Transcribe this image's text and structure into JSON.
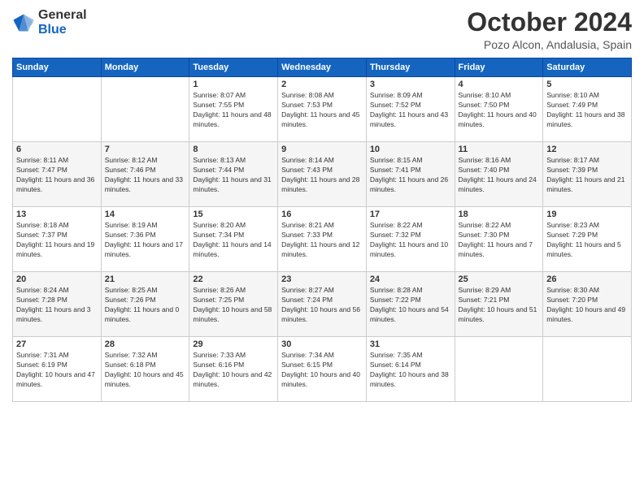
{
  "logo": {
    "general": "General",
    "blue": "Blue"
  },
  "header": {
    "month": "October 2024",
    "location": "Pozo Alcon, Andalusia, Spain"
  },
  "days_of_week": [
    "Sunday",
    "Monday",
    "Tuesday",
    "Wednesday",
    "Thursday",
    "Friday",
    "Saturday"
  ],
  "weeks": [
    [
      {
        "day": "",
        "info": ""
      },
      {
        "day": "",
        "info": ""
      },
      {
        "day": "1",
        "info": "Sunrise: 8:07 AM\nSunset: 7:55 PM\nDaylight: 11 hours and 48 minutes."
      },
      {
        "day": "2",
        "info": "Sunrise: 8:08 AM\nSunset: 7:53 PM\nDaylight: 11 hours and 45 minutes."
      },
      {
        "day": "3",
        "info": "Sunrise: 8:09 AM\nSunset: 7:52 PM\nDaylight: 11 hours and 43 minutes."
      },
      {
        "day": "4",
        "info": "Sunrise: 8:10 AM\nSunset: 7:50 PM\nDaylight: 11 hours and 40 minutes."
      },
      {
        "day": "5",
        "info": "Sunrise: 8:10 AM\nSunset: 7:49 PM\nDaylight: 11 hours and 38 minutes."
      }
    ],
    [
      {
        "day": "6",
        "info": "Sunrise: 8:11 AM\nSunset: 7:47 PM\nDaylight: 11 hours and 36 minutes."
      },
      {
        "day": "7",
        "info": "Sunrise: 8:12 AM\nSunset: 7:46 PM\nDaylight: 11 hours and 33 minutes."
      },
      {
        "day": "8",
        "info": "Sunrise: 8:13 AM\nSunset: 7:44 PM\nDaylight: 11 hours and 31 minutes."
      },
      {
        "day": "9",
        "info": "Sunrise: 8:14 AM\nSunset: 7:43 PM\nDaylight: 11 hours and 28 minutes."
      },
      {
        "day": "10",
        "info": "Sunrise: 8:15 AM\nSunset: 7:41 PM\nDaylight: 11 hours and 26 minutes."
      },
      {
        "day": "11",
        "info": "Sunrise: 8:16 AM\nSunset: 7:40 PM\nDaylight: 11 hours and 24 minutes."
      },
      {
        "day": "12",
        "info": "Sunrise: 8:17 AM\nSunset: 7:39 PM\nDaylight: 11 hours and 21 minutes."
      }
    ],
    [
      {
        "day": "13",
        "info": "Sunrise: 8:18 AM\nSunset: 7:37 PM\nDaylight: 11 hours and 19 minutes."
      },
      {
        "day": "14",
        "info": "Sunrise: 8:19 AM\nSunset: 7:36 PM\nDaylight: 11 hours and 17 minutes."
      },
      {
        "day": "15",
        "info": "Sunrise: 8:20 AM\nSunset: 7:34 PM\nDaylight: 11 hours and 14 minutes."
      },
      {
        "day": "16",
        "info": "Sunrise: 8:21 AM\nSunset: 7:33 PM\nDaylight: 11 hours and 12 minutes."
      },
      {
        "day": "17",
        "info": "Sunrise: 8:22 AM\nSunset: 7:32 PM\nDaylight: 11 hours and 10 minutes."
      },
      {
        "day": "18",
        "info": "Sunrise: 8:22 AM\nSunset: 7:30 PM\nDaylight: 11 hours and 7 minutes."
      },
      {
        "day": "19",
        "info": "Sunrise: 8:23 AM\nSunset: 7:29 PM\nDaylight: 11 hours and 5 minutes."
      }
    ],
    [
      {
        "day": "20",
        "info": "Sunrise: 8:24 AM\nSunset: 7:28 PM\nDaylight: 11 hours and 3 minutes."
      },
      {
        "day": "21",
        "info": "Sunrise: 8:25 AM\nSunset: 7:26 PM\nDaylight: 11 hours and 0 minutes."
      },
      {
        "day": "22",
        "info": "Sunrise: 8:26 AM\nSunset: 7:25 PM\nDaylight: 10 hours and 58 minutes."
      },
      {
        "day": "23",
        "info": "Sunrise: 8:27 AM\nSunset: 7:24 PM\nDaylight: 10 hours and 56 minutes."
      },
      {
        "day": "24",
        "info": "Sunrise: 8:28 AM\nSunset: 7:22 PM\nDaylight: 10 hours and 54 minutes."
      },
      {
        "day": "25",
        "info": "Sunrise: 8:29 AM\nSunset: 7:21 PM\nDaylight: 10 hours and 51 minutes."
      },
      {
        "day": "26",
        "info": "Sunrise: 8:30 AM\nSunset: 7:20 PM\nDaylight: 10 hours and 49 minutes."
      }
    ],
    [
      {
        "day": "27",
        "info": "Sunrise: 7:31 AM\nSunset: 6:19 PM\nDaylight: 10 hours and 47 minutes."
      },
      {
        "day": "28",
        "info": "Sunrise: 7:32 AM\nSunset: 6:18 PM\nDaylight: 10 hours and 45 minutes."
      },
      {
        "day": "29",
        "info": "Sunrise: 7:33 AM\nSunset: 6:16 PM\nDaylight: 10 hours and 42 minutes."
      },
      {
        "day": "30",
        "info": "Sunrise: 7:34 AM\nSunset: 6:15 PM\nDaylight: 10 hours and 40 minutes."
      },
      {
        "day": "31",
        "info": "Sunrise: 7:35 AM\nSunset: 6:14 PM\nDaylight: 10 hours and 38 minutes."
      },
      {
        "day": "",
        "info": ""
      },
      {
        "day": "",
        "info": ""
      }
    ]
  ]
}
